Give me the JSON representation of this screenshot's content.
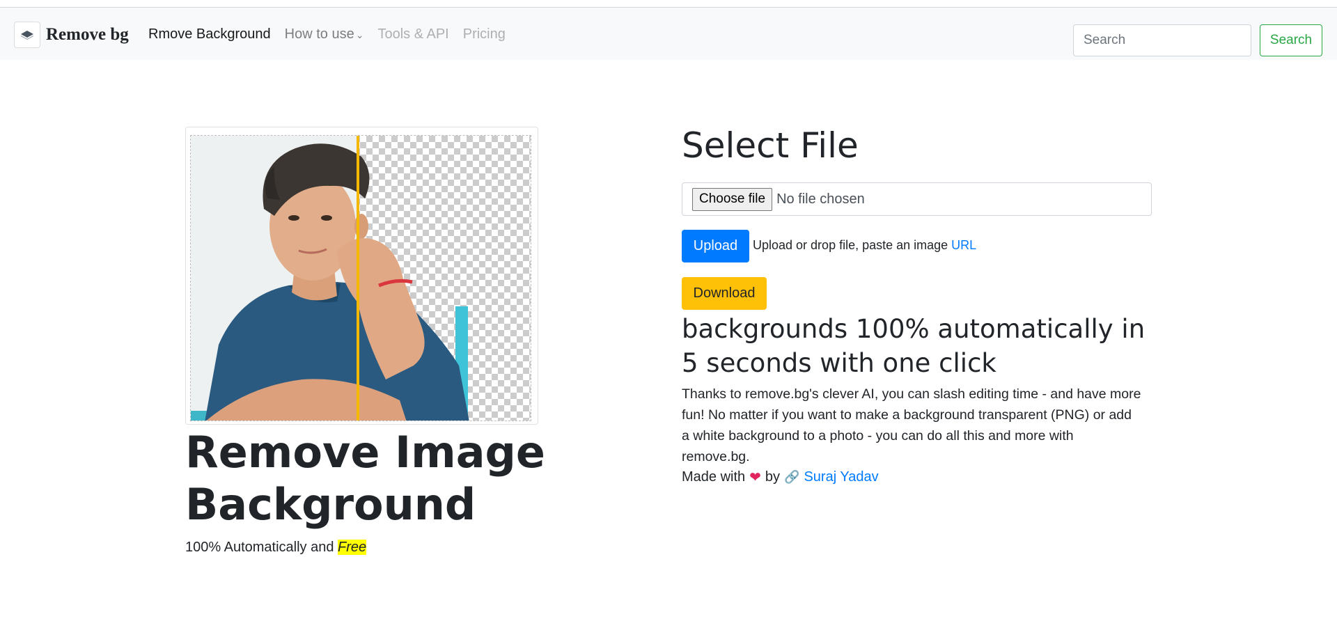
{
  "navbar": {
    "brand": "Remove bg",
    "links": [
      {
        "label": "Rmove Background"
      },
      {
        "label": "How to use"
      },
      {
        "label": "Tools & API"
      },
      {
        "label": "Pricing"
      }
    ],
    "search": {
      "placeholder": "Search",
      "button_label": "Search"
    }
  },
  "hero": {
    "title": "Remove Image Background",
    "subtitle_prefix": "100% Automatically and ",
    "subtitle_highlight": "Free"
  },
  "upload_panel": {
    "title": "Select File",
    "choose_file_label": "Choose file",
    "file_status": "No file chosen",
    "upload_label": "Upload",
    "upload_hint": "Upload or drop file, paste an image ",
    "url_link": "URL",
    "download_label": "Download"
  },
  "info": {
    "tagline": "backgrounds 100% automatically in 5 seconds with one click",
    "description": "Thanks to remove.bg's clever AI, you can slash editing time - and have more fun! No matter if you want to make a background transparent (PNG) or add a white background to a photo - you can do all this and more with remove.bg.",
    "credit_prefix": "Made with",
    "credit_by": "by",
    "author": "Suraj Yadav"
  },
  "colors": {
    "primary": "#007bff",
    "warning": "#ffc107",
    "success": "#28a745",
    "highlight": "#ffff00",
    "divider": "#f5b800"
  },
  "icons": [
    "brand-logo-icon",
    "chevron-down-icon",
    "heart-icon",
    "link-icon"
  ]
}
